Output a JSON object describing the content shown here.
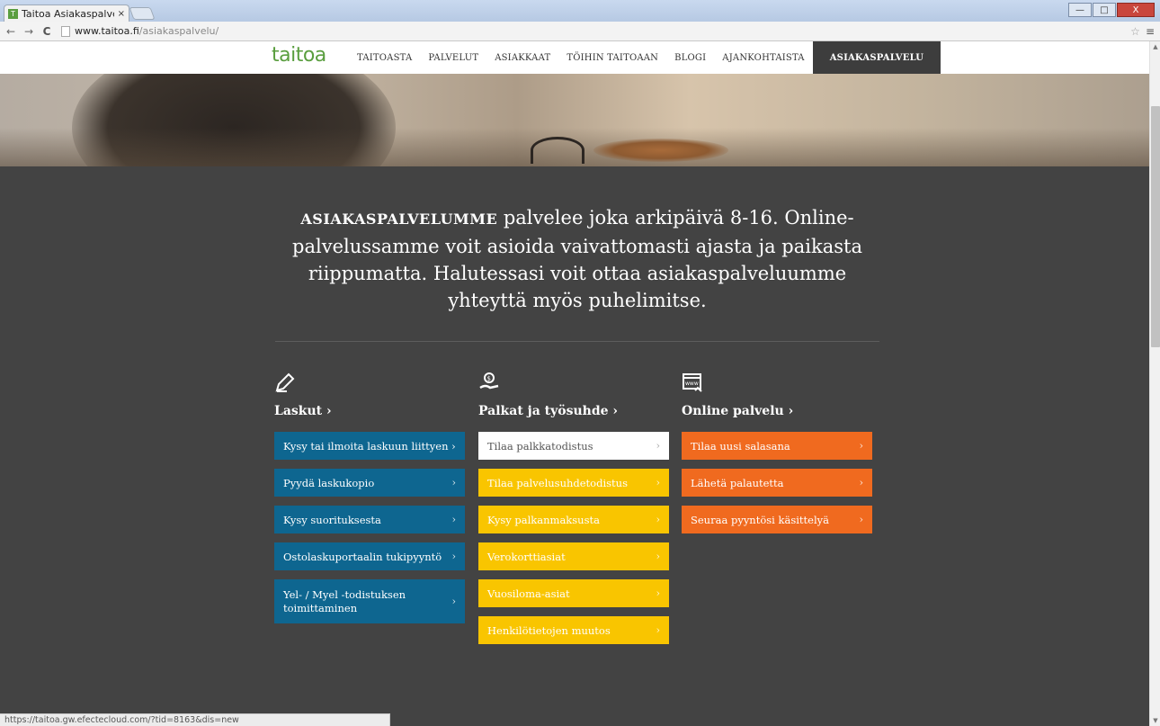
{
  "browser": {
    "tab_title": "Taitoa Asiakaspalvelu",
    "tab_close": "×",
    "url_host": "www.taitoa.fi",
    "url_path": "/asiakaspalvelu/",
    "back": "←",
    "forward": "→",
    "reload": "C",
    "star": "☆",
    "menu": "≡",
    "minimize": "—",
    "maximize": "□",
    "close": "X",
    "status_url": "https://taitoa.gw.efectecloud.com/?tid=8163&dis=new"
  },
  "site": {
    "logo": "taitoa",
    "nav": [
      "TAITOASTA",
      "PALVELUT",
      "ASIAKKAAT",
      "TÖIHIN TAITOAAN",
      "BLOGI",
      "AJANKOHTAISTA",
      "ASIAKASPALVELU"
    ]
  },
  "intro": {
    "lead": "ASIAKASPALVELUMME",
    "text": " palvelee joka arkipäivä 8-16. Online-palvelussamme voit asioida vaivattomasti ajasta ja paikasta riippumatta. Halutessasi voit ottaa asiakaspalveluumme yhteyttä myös puhelimitse."
  },
  "columns": [
    {
      "icon": "pen-icon",
      "title": "Laskut ›",
      "items": [
        "Kysy tai ilmoita laskuun liittyen ›",
        "Pyydä laskukopio",
        "Kysy suorituksesta",
        "Ostolaskuportaalin tukipyyntö",
        "Yel- / Myel -todistuksen toimittaminen"
      ]
    },
    {
      "icon": "money-hand-icon",
      "title": "Palkat ja työsuhde ›",
      "items": [
        "Tilaa palkkatodistus",
        "Tilaa palvelusuhdetodistus",
        "Kysy palkanmaksusta",
        "Verokorttiasiat",
        "Vuosiloma-asiat",
        "Henkilötietojen muutos"
      ]
    },
    {
      "icon": "www-icon",
      "title": "Online palvelu ›",
      "items": [
        "Tilaa uusi salasana",
        "Lähetä palautetta",
        "Seuraa pyyntösi käsittelyä"
      ]
    }
  ],
  "chevron": "›",
  "colors": {
    "blue": "#0e6690",
    "yellow": "#f9c500",
    "orange": "#f06a1f",
    "dark_bg": "#434343",
    "brand_green": "#5a9e3f"
  }
}
